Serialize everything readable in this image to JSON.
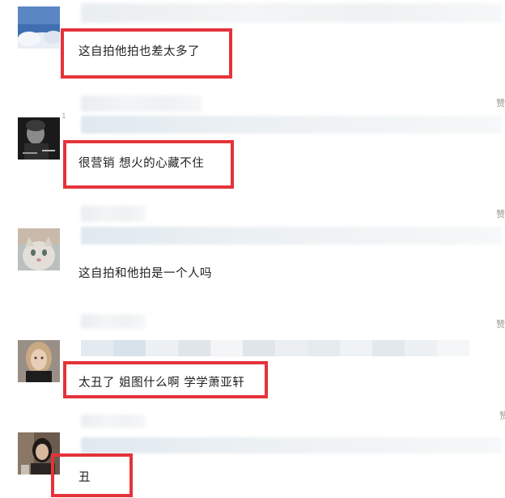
{
  "comments": [
    {
      "text": "这自拍他拍也差太多了",
      "highlighted": true,
      "avatar": "sky-clouds-avatar"
    },
    {
      "text": "很营销 想火的心藏不住",
      "highlighted": true,
      "avatar": "portrait-bw-avatar"
    },
    {
      "text": "这自拍和他拍是一个人吗",
      "highlighted": false,
      "avatar": "cat-avatar"
    },
    {
      "text": "太丑了 姐图什么啊 学学萧亚轩",
      "highlighted": true,
      "avatar": "woman-avatar"
    },
    {
      "text": "丑",
      "highlighted": true,
      "avatar": "woman-dark-avatar"
    }
  ],
  "side_fragment": "赞",
  "tiny_mark": "1",
  "colors": {
    "highlight": "#e5333a",
    "text": "#222222"
  }
}
